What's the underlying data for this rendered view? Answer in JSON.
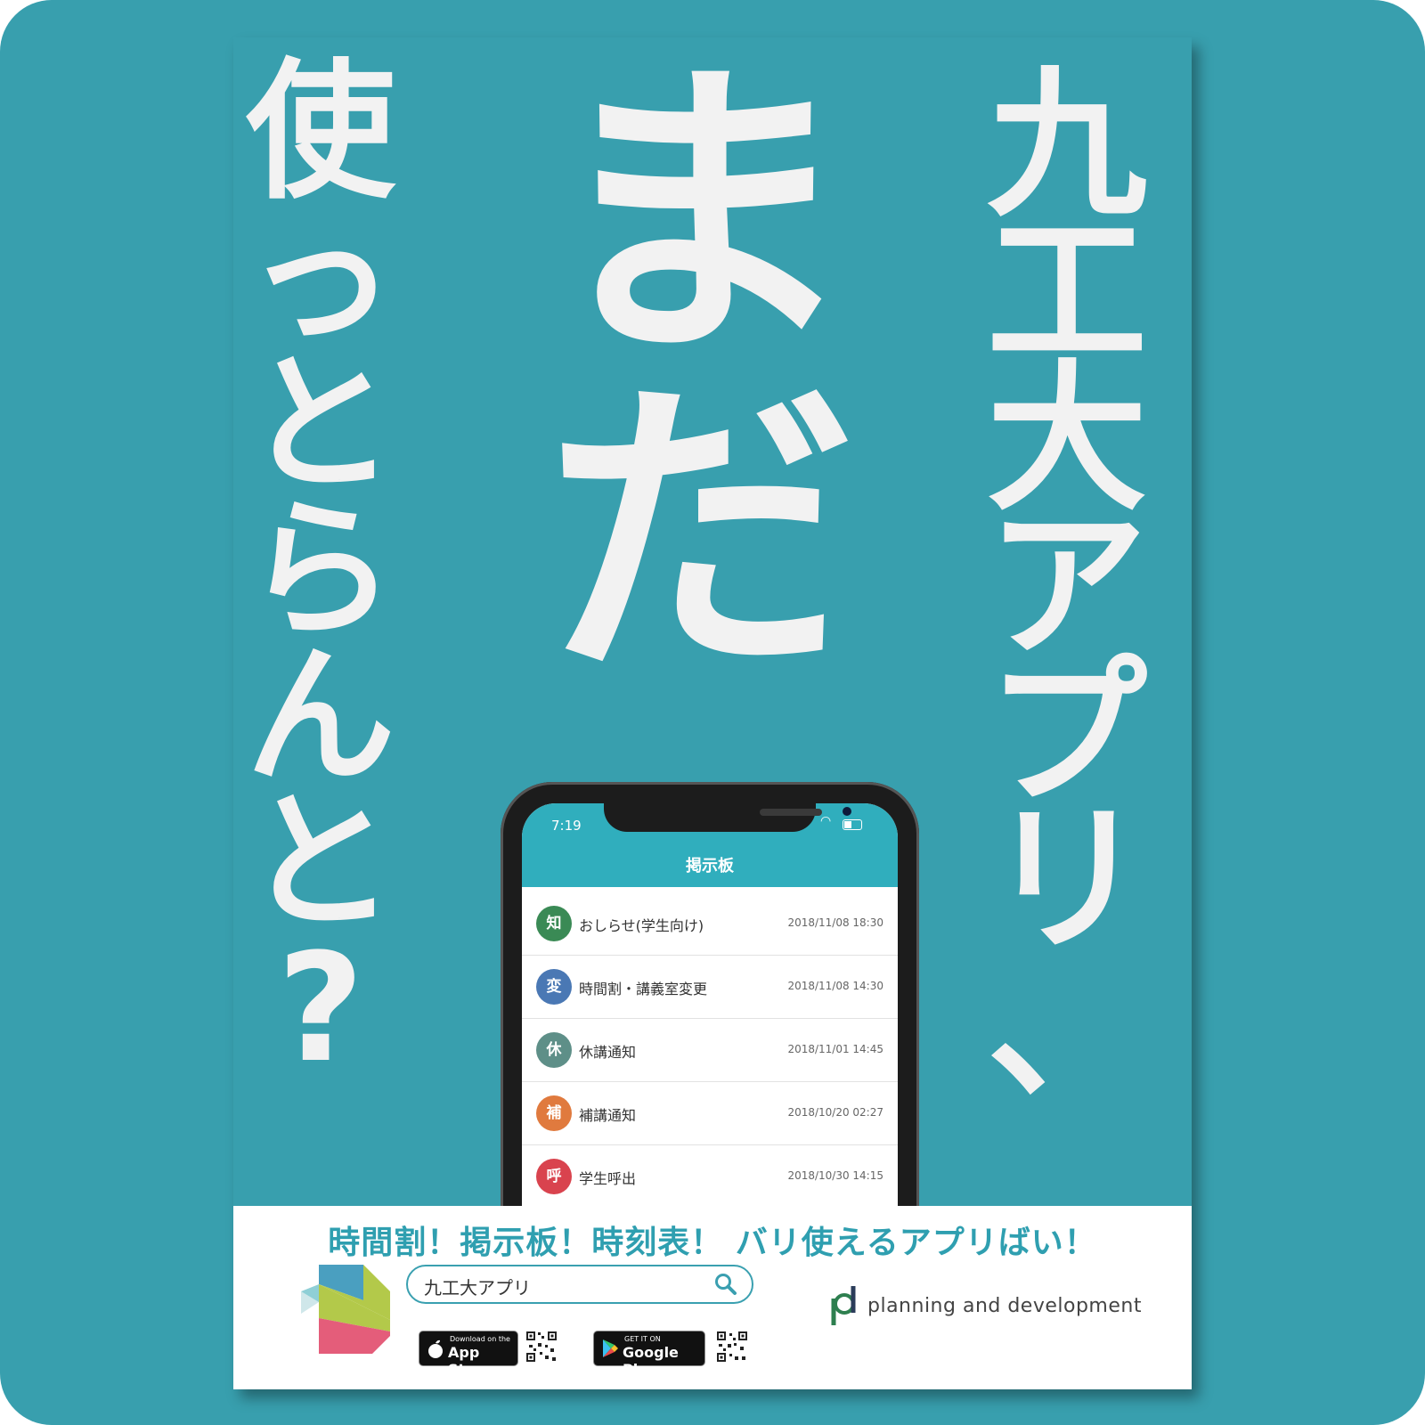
{
  "headline": {
    "left_column": [
      "使",
      "っ",
      "と",
      "ら",
      "ん",
      "と",
      "?"
    ],
    "middle_column": [
      "ま",
      "だ"
    ],
    "right_column": [
      "九",
      "工",
      "大",
      "ア",
      "プ",
      "リ",
      "、"
    ]
  },
  "phone": {
    "status_time": "7:19",
    "header_title": "掲示板",
    "items": [
      {
        "badge": "知",
        "title": "おしらせ(学生向け)",
        "date": "2018/11/08 18:30",
        "color": "#3a8a55"
      },
      {
        "badge": "変",
        "title": "時間割・講義室変更",
        "date": "2018/11/08 14:30",
        "color": "#4a78b4"
      },
      {
        "badge": "休",
        "title": "休講通知",
        "date": "2018/11/01 14:45",
        "color": "#5e8f88"
      },
      {
        "badge": "補",
        "title": "補講通知",
        "date": "2018/10/20 02:27",
        "color": "#e07a3e"
      },
      {
        "badge": "呼",
        "title": "学生呼出",
        "date": "2018/10/30 14:15",
        "color": "#d9434e"
      }
    ]
  },
  "footer": {
    "tagline": "時間割！掲示板！時刻表！ バリ使えるアプリばい！",
    "search_text": "九工大アプリ",
    "app_store_small": "Download on the",
    "app_store_big": "App Store",
    "google_play_small": "GET IT ON",
    "google_play_big": "Google Play",
    "company": "planning and development"
  },
  "colors": {
    "background": "#389fae",
    "accent": "#2f9fb0",
    "app_header": "#30aebd"
  }
}
